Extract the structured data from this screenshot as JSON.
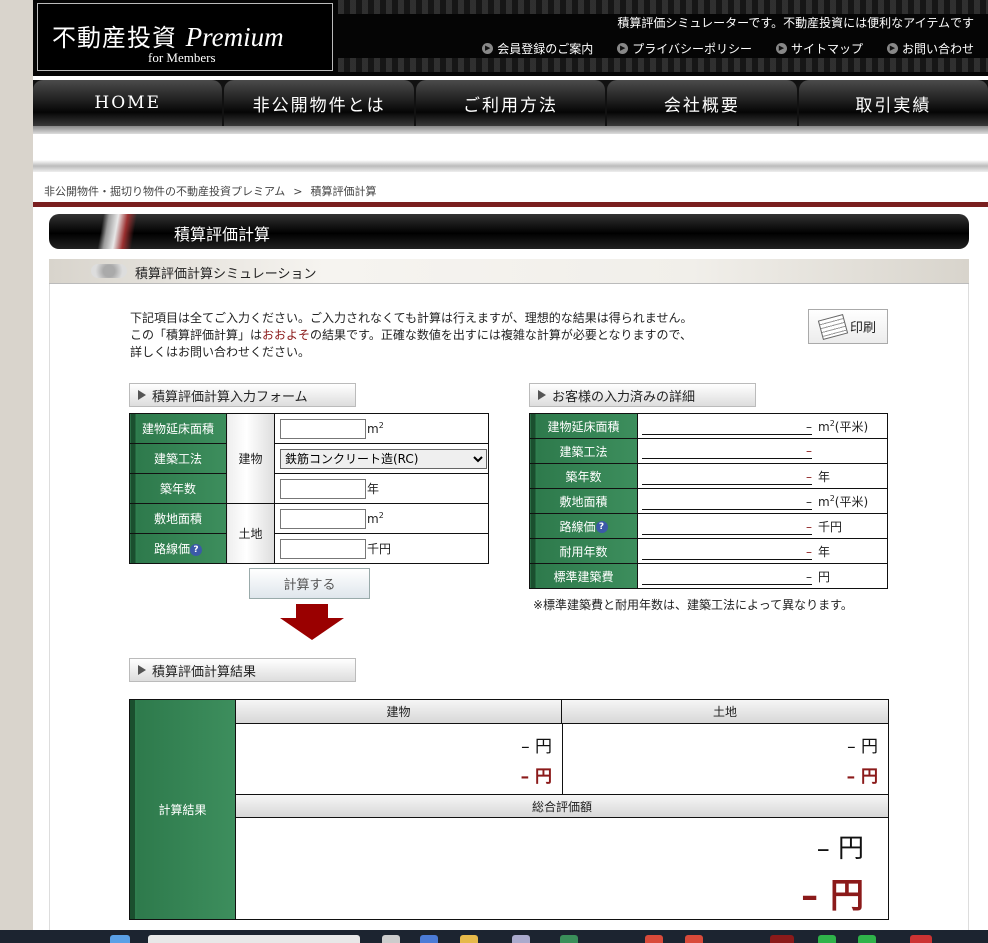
{
  "header": {
    "logo_jp": "不動産投資",
    "logo_en": "Premium",
    "logo_sub": "for Members",
    "tagline": "積算評価シミュレーターです。不動産投資には便利なアイテムです",
    "links": [
      "会員登録のご案内",
      "プライバシーポリシー",
      "サイトマップ",
      "お問い合わせ"
    ]
  },
  "nav": [
    "HOME",
    "非公開物件とは",
    "ご利用方法",
    "会社概要",
    "取引実績"
  ],
  "breadcrumb": {
    "home": "非公開物件・掘切り物件の不動産投資プレミアム",
    "sep": ">",
    "current": "積算評価計算"
  },
  "page_title": "積算評価計算",
  "sub_title": "積算評価計算シミュレーション",
  "intro": {
    "line1": "下記項目は全てご入力ください。ご入力されなくても計算は行えますが、理想的な結果は得られません。",
    "line2a": "この「積算評価計算」は",
    "line2b": "おおよそ",
    "line2c": "の結果です。正確な数値を出すには複雑な計算が必要となりますので、",
    "line3": "詳しくはお問い合わせください。"
  },
  "print_label": "印刷",
  "form": {
    "heading": "積算評価計算入力フォーム",
    "group_building": "建物",
    "group_land": "土地",
    "rows": {
      "floor_area": {
        "label": "建物延床面積",
        "unit_base": "m",
        "unit_sup": "2",
        "value": ""
      },
      "construction": {
        "label": "建築工法",
        "selected": "鉄筋コンクリート造(RC)"
      },
      "age": {
        "label": "築年数",
        "unit": "年",
        "value": ""
      },
      "land_area": {
        "label": "敷地面積",
        "unit_base": "m",
        "unit_sup": "2",
        "value": ""
      },
      "road_price": {
        "label": "路線価",
        "unit": "千円",
        "value": ""
      }
    },
    "help_icon": "?",
    "submit_label": "計算する"
  },
  "details": {
    "heading": "お客様の入力済みの詳細",
    "dash": "–",
    "rows": [
      {
        "label": "建物延床面積",
        "unit_pre": "m",
        "unit_sup": "2",
        "unit_post": "(平米)"
      },
      {
        "label": "建築工法",
        "unit_pre": "",
        "unit_sup": "",
        "unit_post": ""
      },
      {
        "label": "築年数",
        "unit_pre": "年",
        "unit_sup": "",
        "unit_post": ""
      },
      {
        "label": "敷地面積",
        "unit_pre": "m",
        "unit_sup": "2",
        "unit_post": "(平米)"
      },
      {
        "label": "路線価",
        "unit_pre": "千円",
        "unit_sup": "",
        "unit_post": ""
      },
      {
        "label": "耐用年数",
        "unit_pre": "年",
        "unit_sup": "",
        "unit_post": ""
      },
      {
        "label": "標準建築費",
        "unit_pre": "円",
        "unit_sup": "",
        "unit_post": ""
      }
    ],
    "note": "※標準建築費と耐用年数は、建築工法によって異なります。"
  },
  "result": {
    "heading": "積算評価計算結果",
    "label": "計算結果",
    "col_building": "建物",
    "col_land": "土地",
    "total_label": "総合評価額",
    "building_value": "– 円",
    "building_value2": "– 円",
    "land_value": "– 円",
    "land_value2": "– 円",
    "total_value": "– 円",
    "total_value2": "– 円"
  },
  "colors": {
    "accent_red": "#8b1a1a",
    "label_green": "#2e7a4c",
    "header_black": "#050505"
  }
}
